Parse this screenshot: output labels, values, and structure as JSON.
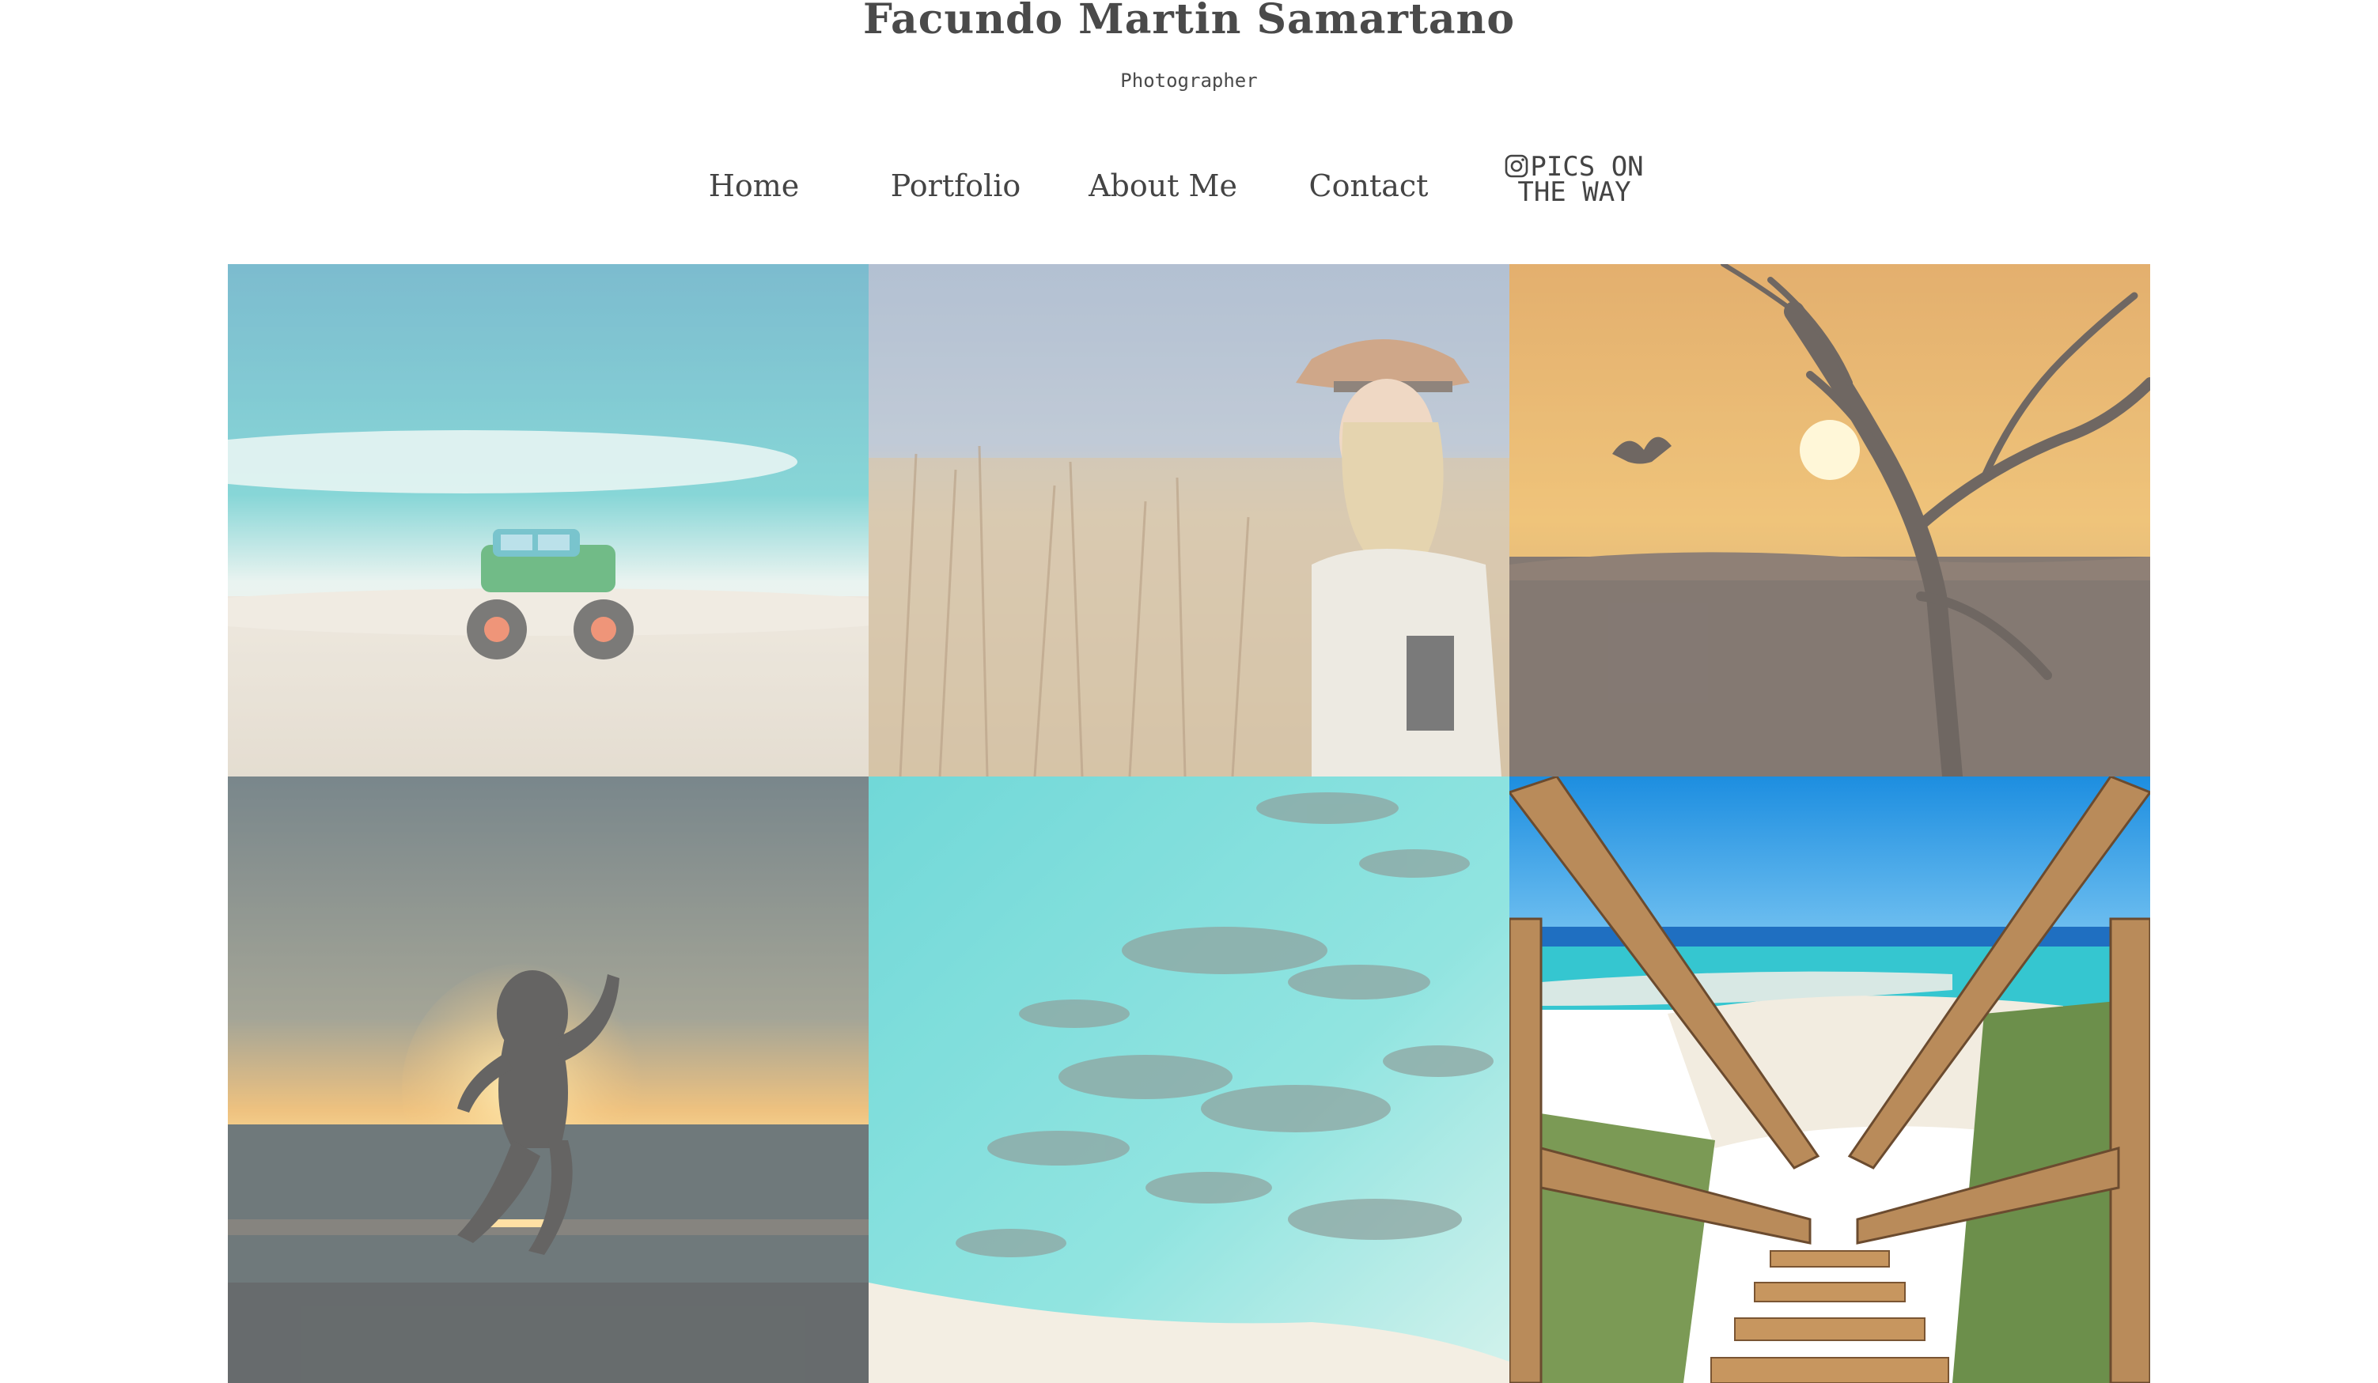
{
  "header": {
    "title": "Facundo Martin Samartano",
    "subtitle": "Photographer"
  },
  "nav": {
    "home": "Home",
    "portfolio": "Portfolio",
    "about": "About Me",
    "contact": "Contact",
    "instagram_line1": "PICS ON",
    "instagram_line2": "THE WAY",
    "instagram_icon": "instagram-icon"
  },
  "gallery": {
    "photos": [
      {
        "subject": "toy-monster-truck-on-beach"
      },
      {
        "subject": "woman-in-hat-in-grass-field"
      },
      {
        "subject": "sunset-tree-silhouette-with-bird"
      },
      {
        "subject": "child-jumping-at-sunset-beach"
      },
      {
        "subject": "aerial-turquoise-sea-reef"
      },
      {
        "subject": "wooden-stairs-to-beach"
      }
    ]
  },
  "colors": {
    "text": "#4a4a4a",
    "background": "#ffffff"
  }
}
